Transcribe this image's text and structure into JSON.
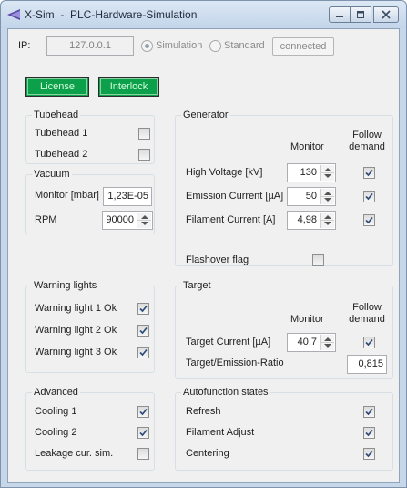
{
  "window": {
    "title": "X-Sim  -  PLC-Hardware-Simulation",
    "controls": [
      "minimize-icon",
      "maximize-icon",
      "close-icon"
    ]
  },
  "connection": {
    "ip_label": "IP:",
    "ip_value": "127.0.0.1",
    "mode_simulation": "Simulation",
    "mode_standard": "Standard",
    "selected_mode": "Simulation",
    "connected_label": "connected"
  },
  "actions": {
    "license_label": "License",
    "interlock_label": "Interlock",
    "indicator_color": "#0ca04a"
  },
  "tubehead": {
    "title": "Tubehead",
    "items": [
      {
        "label": "Tubehead 1",
        "checked": false
      },
      {
        "label": "Tubehead 2",
        "checked": false
      }
    ]
  },
  "vacuum": {
    "title": "Vacuum",
    "monitor_label": "Monitor [mbar]",
    "monitor_value": "1,23E-05",
    "rpm_label": "RPM",
    "rpm_value": "90000"
  },
  "generator": {
    "title": "Generator",
    "monitor_header": "Monitor",
    "follow_header_1": "Follow",
    "follow_header_2": "demand",
    "rows": [
      {
        "label": "High Voltage [kV]",
        "value": "130",
        "follow": true
      },
      {
        "label": "Emission Current [µA]",
        "value": "50",
        "follow": true
      },
      {
        "label": "Filament Current [A]",
        "value": "4,98",
        "follow": true
      }
    ],
    "flashover_label": "Flashover flag",
    "flashover_checked": false
  },
  "warning_lights": {
    "title": "Warning lights",
    "items": [
      {
        "label": "Warning light 1 Ok",
        "checked": true
      },
      {
        "label": "Warning light 2 Ok",
        "checked": true
      },
      {
        "label": "Warning light 3 Ok",
        "checked": true
      }
    ]
  },
  "target": {
    "title": "Target",
    "monitor_header": "Monitor",
    "follow_header_1": "Follow",
    "follow_header_2": "demand",
    "current_label": "Target Current [µA]",
    "current_value": "40,7",
    "current_follow": true,
    "ratio_label": "Target/Emission-Ratio",
    "ratio_value": "0,815"
  },
  "advanced": {
    "title": "Advanced",
    "items": [
      {
        "label": "Cooling 1",
        "checked": true
      },
      {
        "label": "Cooling 2",
        "checked": true
      },
      {
        "label": "Leakage cur. sim.",
        "checked": false
      }
    ]
  },
  "autofunction": {
    "title": "Autofunction states",
    "items": [
      {
        "label": "Refresh",
        "checked": true
      },
      {
        "label": "Filament Adjust",
        "checked": true
      },
      {
        "label": "Centering",
        "checked": true
      }
    ]
  }
}
